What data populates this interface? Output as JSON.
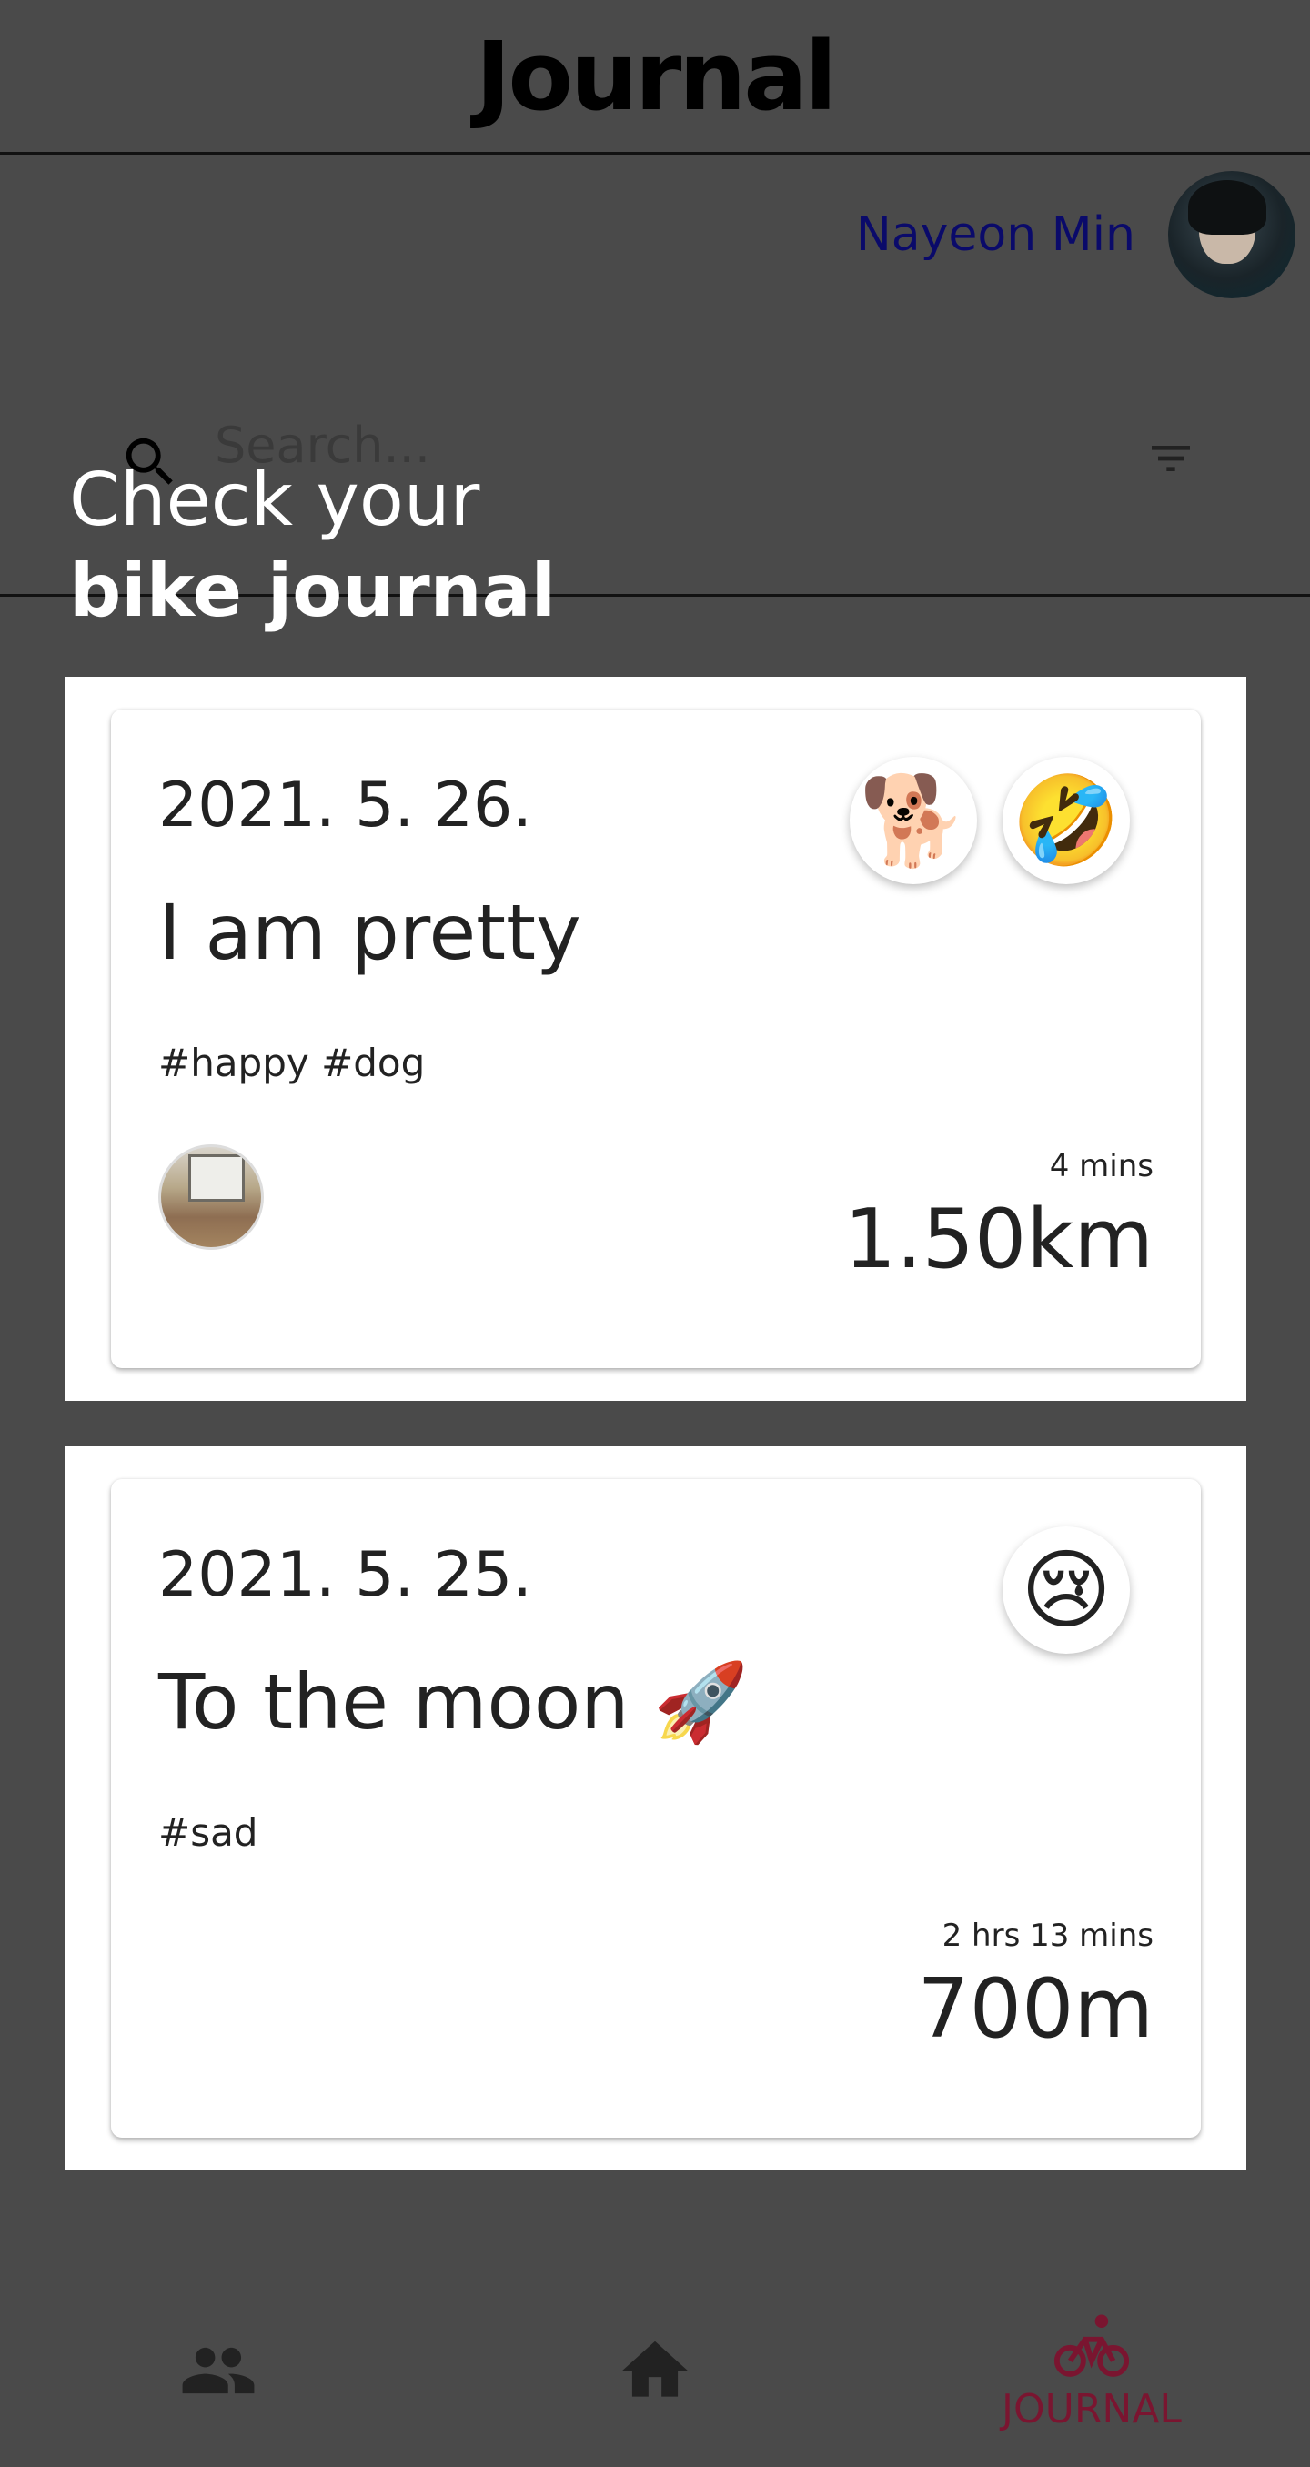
{
  "header": {
    "title": "Journal"
  },
  "profile": {
    "name": "Nayeon Min"
  },
  "search": {
    "placeholder": "Search..."
  },
  "hero": {
    "line1": "Check your",
    "line2": "bike journal"
  },
  "entries": [
    {
      "date": "2021. 5. 26.",
      "title": "I am pretty",
      "tags": "#happy #dog",
      "emojis": [
        "🐕",
        "🤣"
      ],
      "duration": "4 mins",
      "distance": "1.50km"
    },
    {
      "date": "2021. 5. 25.",
      "title": "To the moon 🚀",
      "tags": "#sad",
      "emojis": [
        "😢"
      ],
      "duration": "2 hrs 13 mins",
      "distance": "700m"
    }
  ],
  "nav": {
    "items": [
      {
        "icon": "people-icon"
      },
      {
        "icon": "home-icon"
      },
      {
        "icon": "bike-icon",
        "label": "JOURNAL"
      }
    ],
    "active_color": "#7a1530"
  },
  "colors": {
    "background": "#4a4a4a",
    "profile_name": "#0a0a6a",
    "accent": "#7a1530"
  }
}
